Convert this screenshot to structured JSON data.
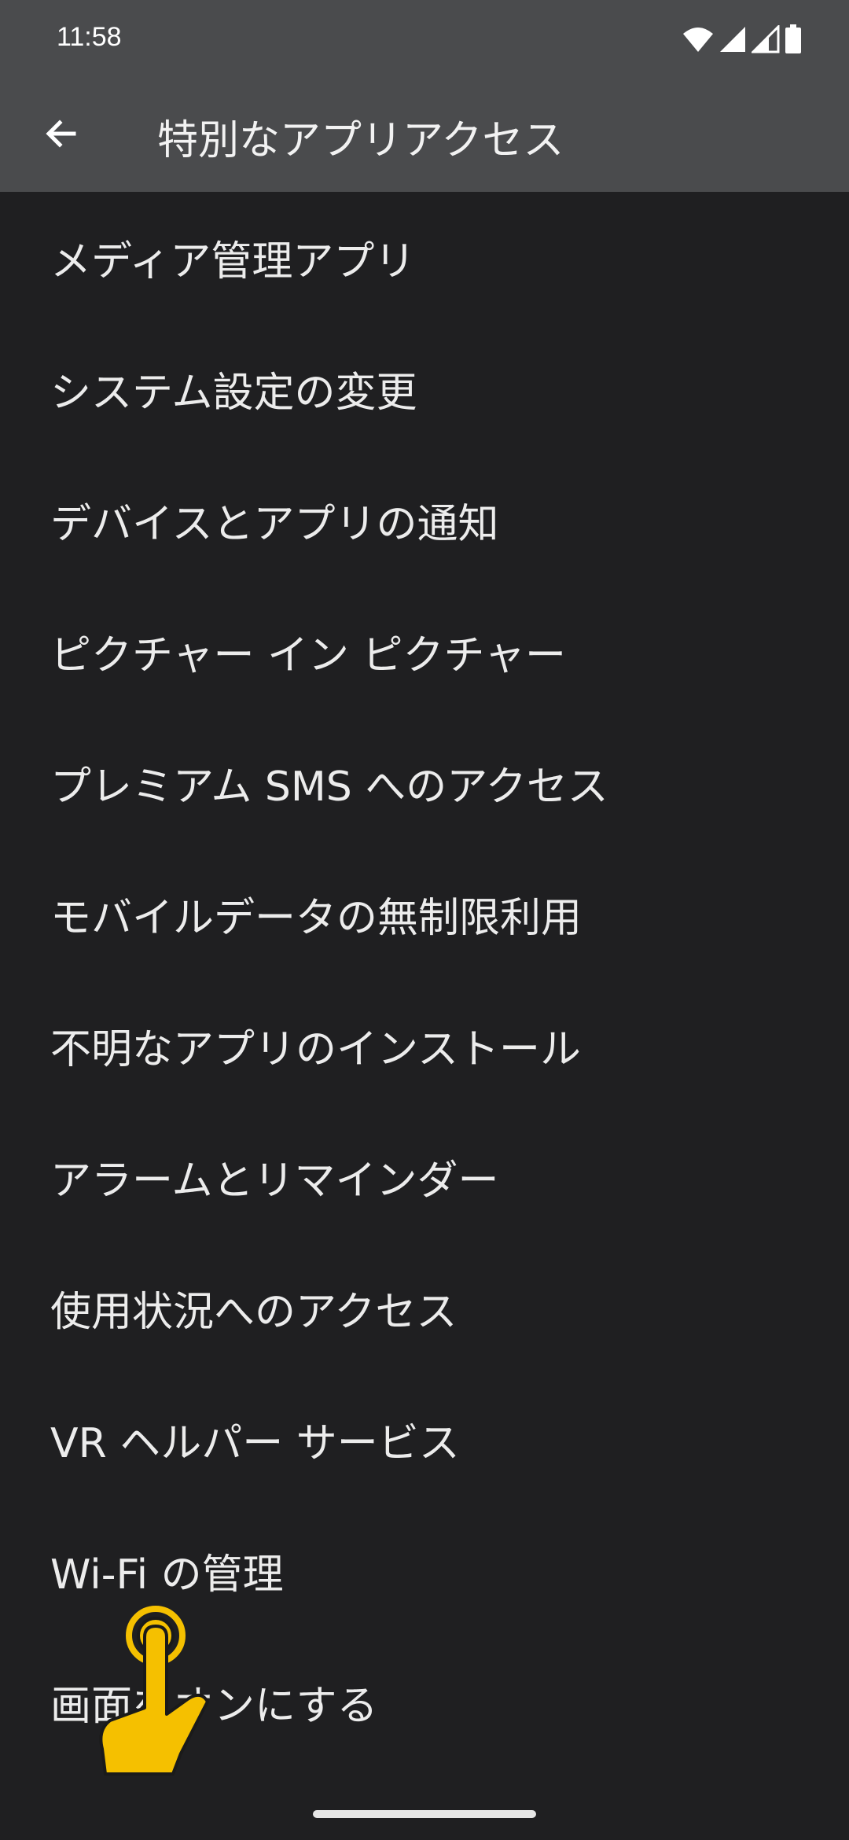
{
  "status_bar": {
    "time": "11:58",
    "icons": [
      "wifi-icon",
      "signal-full-icon",
      "signal-partial-icon",
      "battery-icon"
    ]
  },
  "app_bar": {
    "back_icon": "arrow-left-icon",
    "title": "特別なアプリアクセス"
  },
  "list": {
    "items": [
      {
        "label": "メディア管理アプリ"
      },
      {
        "label": "システム設定の変更"
      },
      {
        "label": "デバイスとアプリの通知"
      },
      {
        "label": "ピクチャー イン ピクチャー"
      },
      {
        "label": "プレミアム SMS へのアクセス"
      },
      {
        "label": "モバイルデータの無制限利用"
      },
      {
        "label": "不明なアプリのインストール"
      },
      {
        "label": "アラームとリマインダー"
      },
      {
        "label": "使用状況へのアクセス"
      },
      {
        "label": "VR ヘルパー サービス"
      },
      {
        "label": "Wi-Fi の管理"
      },
      {
        "label": "画面をオンにする"
      }
    ]
  },
  "colors": {
    "background": "#1f1f21",
    "toolbar": "#4a4b4d",
    "text": "#ececec",
    "touch_indicator": "#f5c000"
  },
  "overlay": {
    "touch_icon": "pointing-hand-icon"
  }
}
